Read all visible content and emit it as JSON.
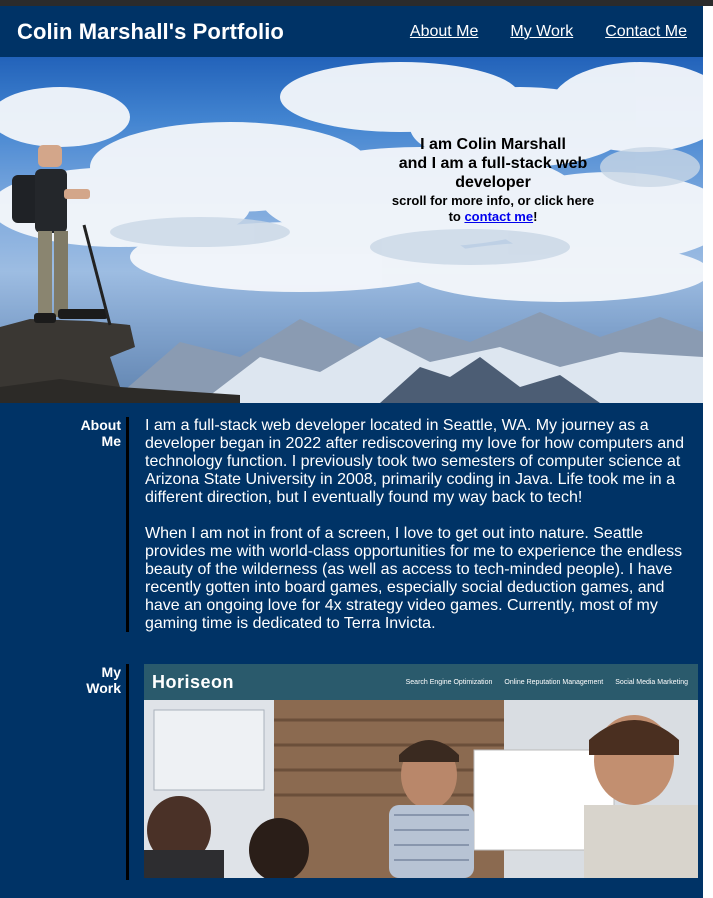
{
  "header": {
    "title": "Colin Marshall's Portfolio",
    "nav": [
      "About Me",
      "My Work",
      "Contact Me"
    ]
  },
  "hero": {
    "headline_line1": "I am Colin Marshall",
    "headline_line2": "and I am a full-stack web developer",
    "sub_prefix": "scroll for more info, or click here to ",
    "sub_link": "contact me",
    "sub_suffix": "!"
  },
  "about": {
    "label": "About Me",
    "paragraphs": [
      "I am a full-stack web developer located in Seattle, WA. My journey as a developer began in 2022 after rediscovering my love for how computers and technology function. I previously took two semesters of computer science at Arizona State University in 2008, primarily coding in Java. Life took me in a different direction, but I eventually found my way back to tech!",
      "When I am not in front of a screen, I love to get out into nature. Seattle provides me with world-class opportunities for me to experience the endless beauty of the wilderness (as well as access to tech-minded people). I have recently gotten into board games, especially social deduction games, and have an ongoing love for 4x strategy video games. Currently, most of my gaming time is dedicated to Terra Invicta."
    ]
  },
  "work": {
    "label": "My Work",
    "project": {
      "logo": "Horiseon",
      "nav": [
        "Search Engine Optimization",
        "Online Reputation Management",
        "Social Media Marketing"
      ]
    }
  },
  "colors": {
    "navy": "#003366",
    "link": "#0000ee"
  }
}
